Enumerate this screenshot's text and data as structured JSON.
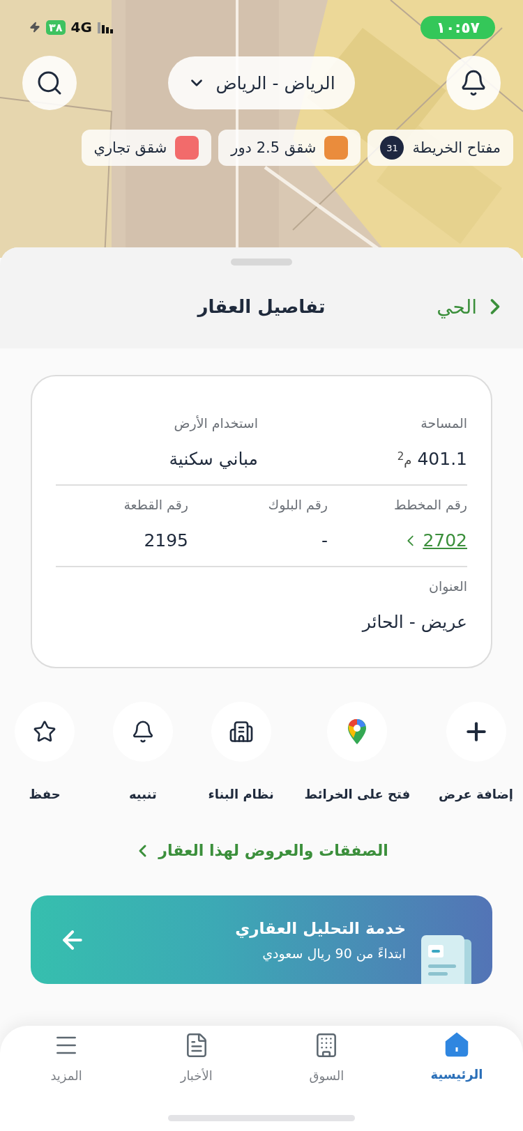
{
  "status_bar": {
    "time": "١٠:٥٧",
    "battery": "٣٨",
    "network": "4G"
  },
  "city_selector": {
    "label": "الرياض - الرياض"
  },
  "map_legend": {
    "title": "مفتاح الخريطة",
    "count": "31",
    "items": [
      {
        "label": "شقق 2.5 دور",
        "color": "#ea8c3c"
      },
      {
        "label": "شقق تجاري",
        "color": "#f26b6b"
      }
    ]
  },
  "sheet": {
    "back_label": "الحي",
    "title": "تفاصيل العقار"
  },
  "details": {
    "rows": [
      [
        {
          "label": "المساحة",
          "value": "401.1",
          "unit": "م$^{2}$",
          "kind": "text"
        },
        {
          "label": "استخدام الأرض",
          "value": "مباني سكنية",
          "kind": "text"
        }
      ],
      [
        {
          "label": "رقم المخطط",
          "value": "2702",
          "kind": "link"
        },
        {
          "label": "رقم البلوك",
          "value": "-",
          "kind": "text"
        },
        {
          "label": "رقم القطعة",
          "value": "2195",
          "kind": "text"
        }
      ],
      [
        {
          "label": "العنوان",
          "value": "عريض - الحائر",
          "kind": "text"
        }
      ]
    ]
  },
  "actions": [
    {
      "label": "إضافة عرض"
    },
    {
      "label": "فتح على الخرائط"
    },
    {
      "label": "نظام البناء"
    },
    {
      "label": "تنبيه"
    },
    {
      "label": "حفظ"
    }
  ],
  "deals_link": "الصفقات والعروض لهذا العقار",
  "promo": {
    "title": "خدمة التحليل العقاري",
    "subtitle": "ابتداءً من 90 ريال سعودي"
  },
  "nav": [
    {
      "label": "الرئيسية",
      "selected": true
    },
    {
      "label": "السوق",
      "selected": false
    },
    {
      "label": "الأخبار",
      "selected": false
    },
    {
      "label": "المزيد",
      "selected": false
    }
  ]
}
